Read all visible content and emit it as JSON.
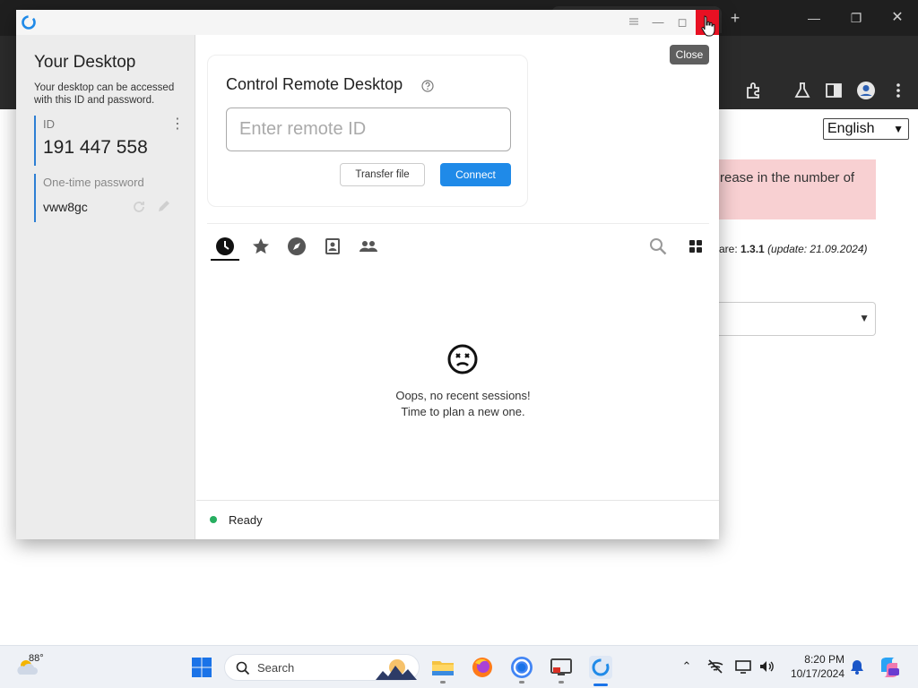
{
  "browser": {
    "new_tab_label": "+",
    "language_select": {
      "value": "English"
    },
    "alert_text": "rease in the number of",
    "version": {
      "prefix": "are: ",
      "number": "1.3.1",
      "update": "(update: 21.09.2024)"
    }
  },
  "app": {
    "title_bar": {
      "menu_icon": "hamburger-icon"
    },
    "sidebar": {
      "title": "Your Desktop",
      "description": "Your desktop can be accessed with this ID and password.",
      "id_label": "ID",
      "id_value": "191 447 558",
      "kebab": "⋮",
      "password_label": "One-time password",
      "password_value": "vww8gc"
    },
    "connect": {
      "title": "Control Remote Desktop",
      "input_placeholder": "Enter remote ID",
      "transfer_label": "Transfer file",
      "connect_label": "Connect"
    },
    "tabs": [
      {
        "icon": "clock-icon"
      },
      {
        "icon": "star-icon"
      },
      {
        "icon": "compass-icon"
      },
      {
        "icon": "address-book-icon"
      },
      {
        "icon": "group-icon"
      }
    ],
    "empty_state": {
      "line1": "Oops, no recent sessions!",
      "line2": "Time to plan a new one."
    },
    "status": {
      "text": "Ready",
      "color": "#27ae60"
    },
    "tooltip": "Close",
    "accent_color": "#1f8ae8"
  },
  "taskbar": {
    "weather_temp": "88°",
    "search_label": "Search",
    "clock_time": "8:20 PM",
    "clock_date": "10/17/2024"
  }
}
